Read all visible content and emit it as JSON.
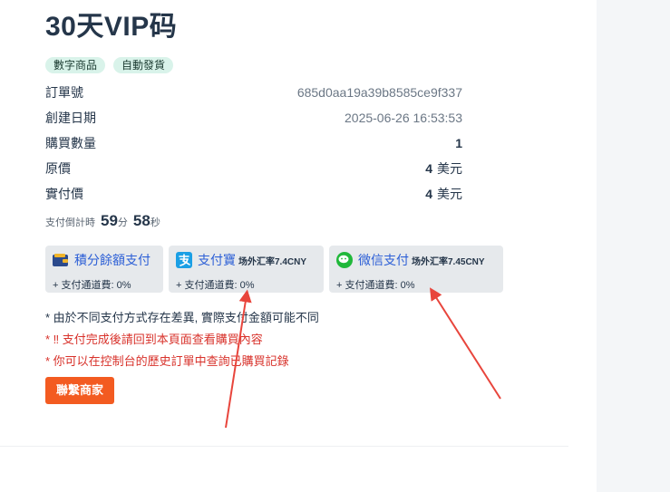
{
  "product": {
    "title": "30天VIP码",
    "tags": [
      "數字商品",
      "自動發貨"
    ]
  },
  "order": {
    "order_no_label": "訂單號",
    "order_no": "685d0aa19a39b8585ce9f337",
    "created_label": "創建日期",
    "created": "2025-06-26 16:53:53",
    "quantity_label": "購買數量",
    "quantity": "1",
    "original_price_label": "原價",
    "original_price_amount": "4",
    "original_price_unit": "美元",
    "paid_price_label": "實付價",
    "paid_price_amount": "4",
    "paid_price_unit": "美元"
  },
  "countdown": {
    "label": "支付倒計時",
    "minutes": "59",
    "minutes_unit": "分",
    "seconds": "58",
    "seconds_unit": "秒"
  },
  "payment_methods": [
    {
      "icon": "wallet-icon",
      "name": "積分餘額支付",
      "rate": "",
      "fee": "+ 支付通道費: 0%"
    },
    {
      "icon": "alipay-icon",
      "name": "支付寶",
      "rate": "场外汇率7.4CNY",
      "fee": "+ 支付通道費: 0%"
    },
    {
      "icon": "wechat-icon",
      "name": "微信支付",
      "rate": "场外汇率7.45CNY",
      "fee": "+ 支付通道費: 0%"
    }
  ],
  "notes": [
    "* 由於不同支付方式存在差異, 實際支付金額可能不同",
    "* ‼ 支付完成後請回到本頁面查看購買內容",
    "* 你可以在控制台的歷史訂單中查詢已購買記錄"
  ],
  "contact_button": "聯繫商家",
  "colors": {
    "link_blue": "#2c5fd6",
    "warning_red": "#d8322b",
    "button_orange": "#f35b21",
    "tag_bg": "#d9f3ea",
    "annotation_arrow": "#e8453c"
  }
}
